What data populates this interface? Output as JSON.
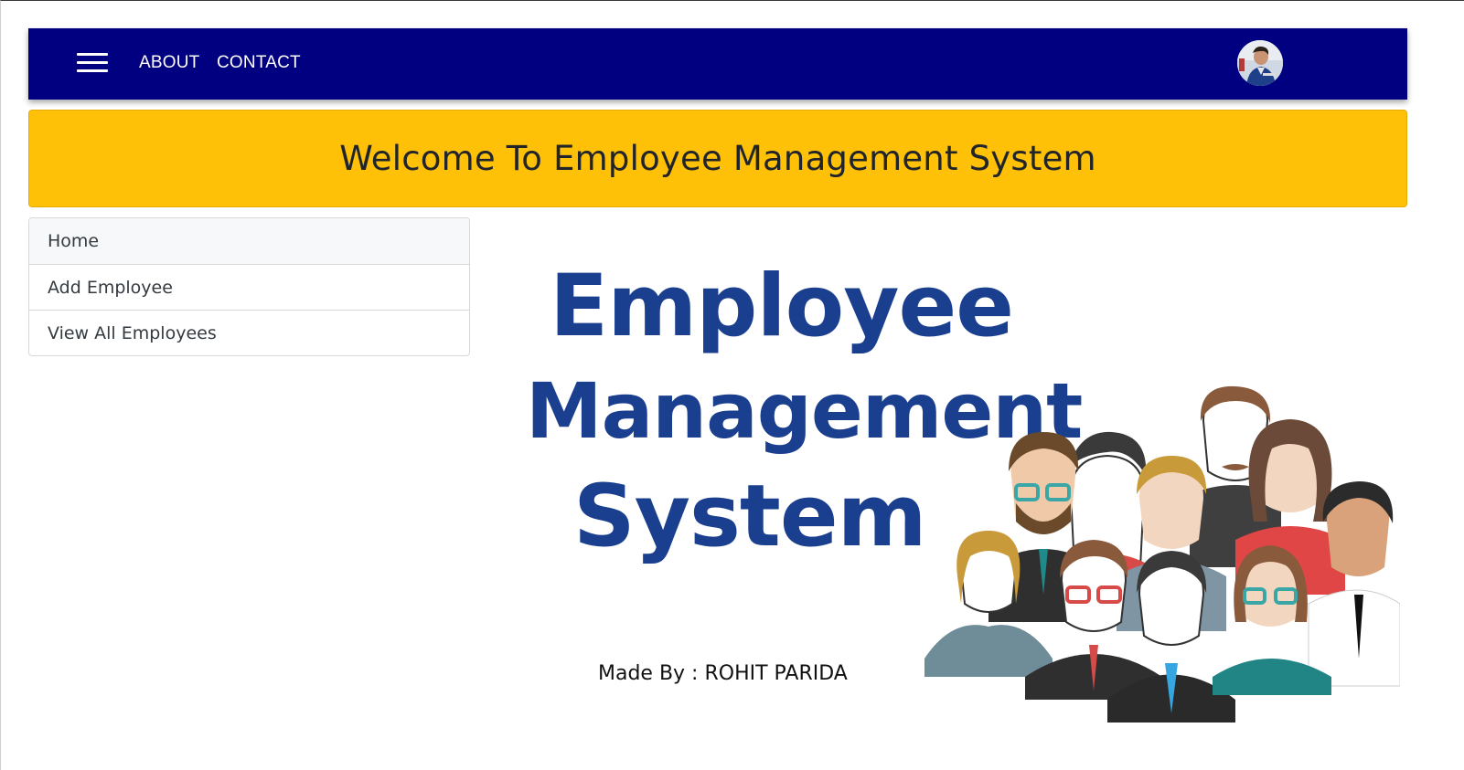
{
  "navbar": {
    "background": "#000080",
    "links": [
      {
        "label": "ABOUT"
      },
      {
        "label": "CONTACT"
      }
    ],
    "menu_icon": "hamburger-menu-icon",
    "avatar_icon": "user-avatar"
  },
  "banner": {
    "title": "Welcome To Employee Management System",
    "background": "#ffc107"
  },
  "sidebar": {
    "items": [
      {
        "label": "Home"
      },
      {
        "label": "Add Employee"
      },
      {
        "label": "View All Employees"
      }
    ]
  },
  "hero": {
    "line1": "Employee",
    "line2": "Management",
    "line3": "System",
    "credit": "Made By : ROHIT PARIDA",
    "text_color": "#1a3f8f",
    "illustration": "employee-group-illustration"
  }
}
